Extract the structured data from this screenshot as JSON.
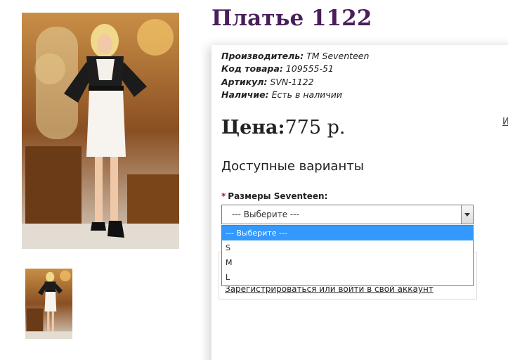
{
  "product": {
    "title": "Платье 1122",
    "specs": [
      {
        "label": "Производитель:",
        "value": "TM Seventeen"
      },
      {
        "label": "Код товара:",
        "value": "109555-51"
      },
      {
        "label": "Артикул:",
        "value": "SVN-1122"
      },
      {
        "label": "Наличие:",
        "value": "Есть в наличии"
      }
    ],
    "price_label": "Цена:",
    "price_value": "775 р.",
    "side_link": "И"
  },
  "variants": {
    "heading": "Доступные варианты",
    "required_mark": "*",
    "size_label": "Размеры Seventeen:",
    "selected_value": "--- Выберите ---",
    "options": [
      "--- Выберите ---",
      "S",
      "M",
      "L"
    ]
  },
  "account": {
    "login_link": "Зарегистрироваться или войти в свой аккаунт"
  },
  "images": {
    "main": "product-photo",
    "thumbnail": "product-thumbnail"
  }
}
